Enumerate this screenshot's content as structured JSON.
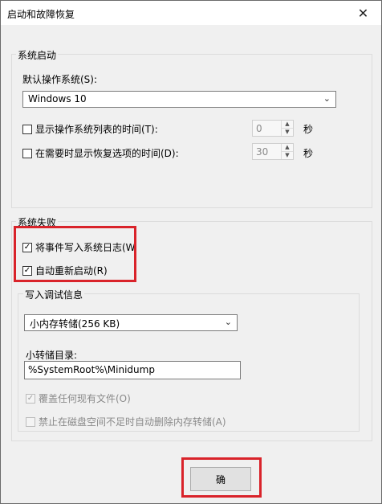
{
  "window": {
    "title": "启动和故障恢复"
  },
  "startup": {
    "group_label": "系统启动",
    "default_os_label": "默认操作系统(S):",
    "default_os_value": "Windows 10",
    "show_list_label": "显示操作系统列表的时间(T):",
    "show_list_value": "0",
    "show_recovery_label": "在需要时显示恢复选项的时间(D):",
    "show_recovery_value": "30",
    "seconds_unit": "秒"
  },
  "failure": {
    "group_label": "系统失败",
    "write_event_label": "将事件写入系统日志(W",
    "write_event_checked": true,
    "auto_restart_label": "自动重新启动(R)",
    "auto_restart_checked": true
  },
  "debug": {
    "group_label": "写入调试信息",
    "dump_type_value": "小内存转储(256 KB)",
    "dir_label": "小转储目录:",
    "dir_value": "%SystemRoot%\\Minidump",
    "overwrite_label": "覆盖任何现有文件(O)",
    "overwrite_checked": true,
    "disable_autodelete_label": "禁止在磁盘空间不足时自动删除内存转储(A)",
    "disable_autodelete_checked": false
  },
  "footer": {
    "ok_label": "确"
  },
  "icons": {
    "close": "close-icon",
    "chevron": "chevron-down-icon",
    "check": "checkmark-icon",
    "spin_up": "spin-up-icon",
    "spin_down": "spin-down-icon"
  },
  "colors": {
    "highlight": "#d9232a"
  }
}
